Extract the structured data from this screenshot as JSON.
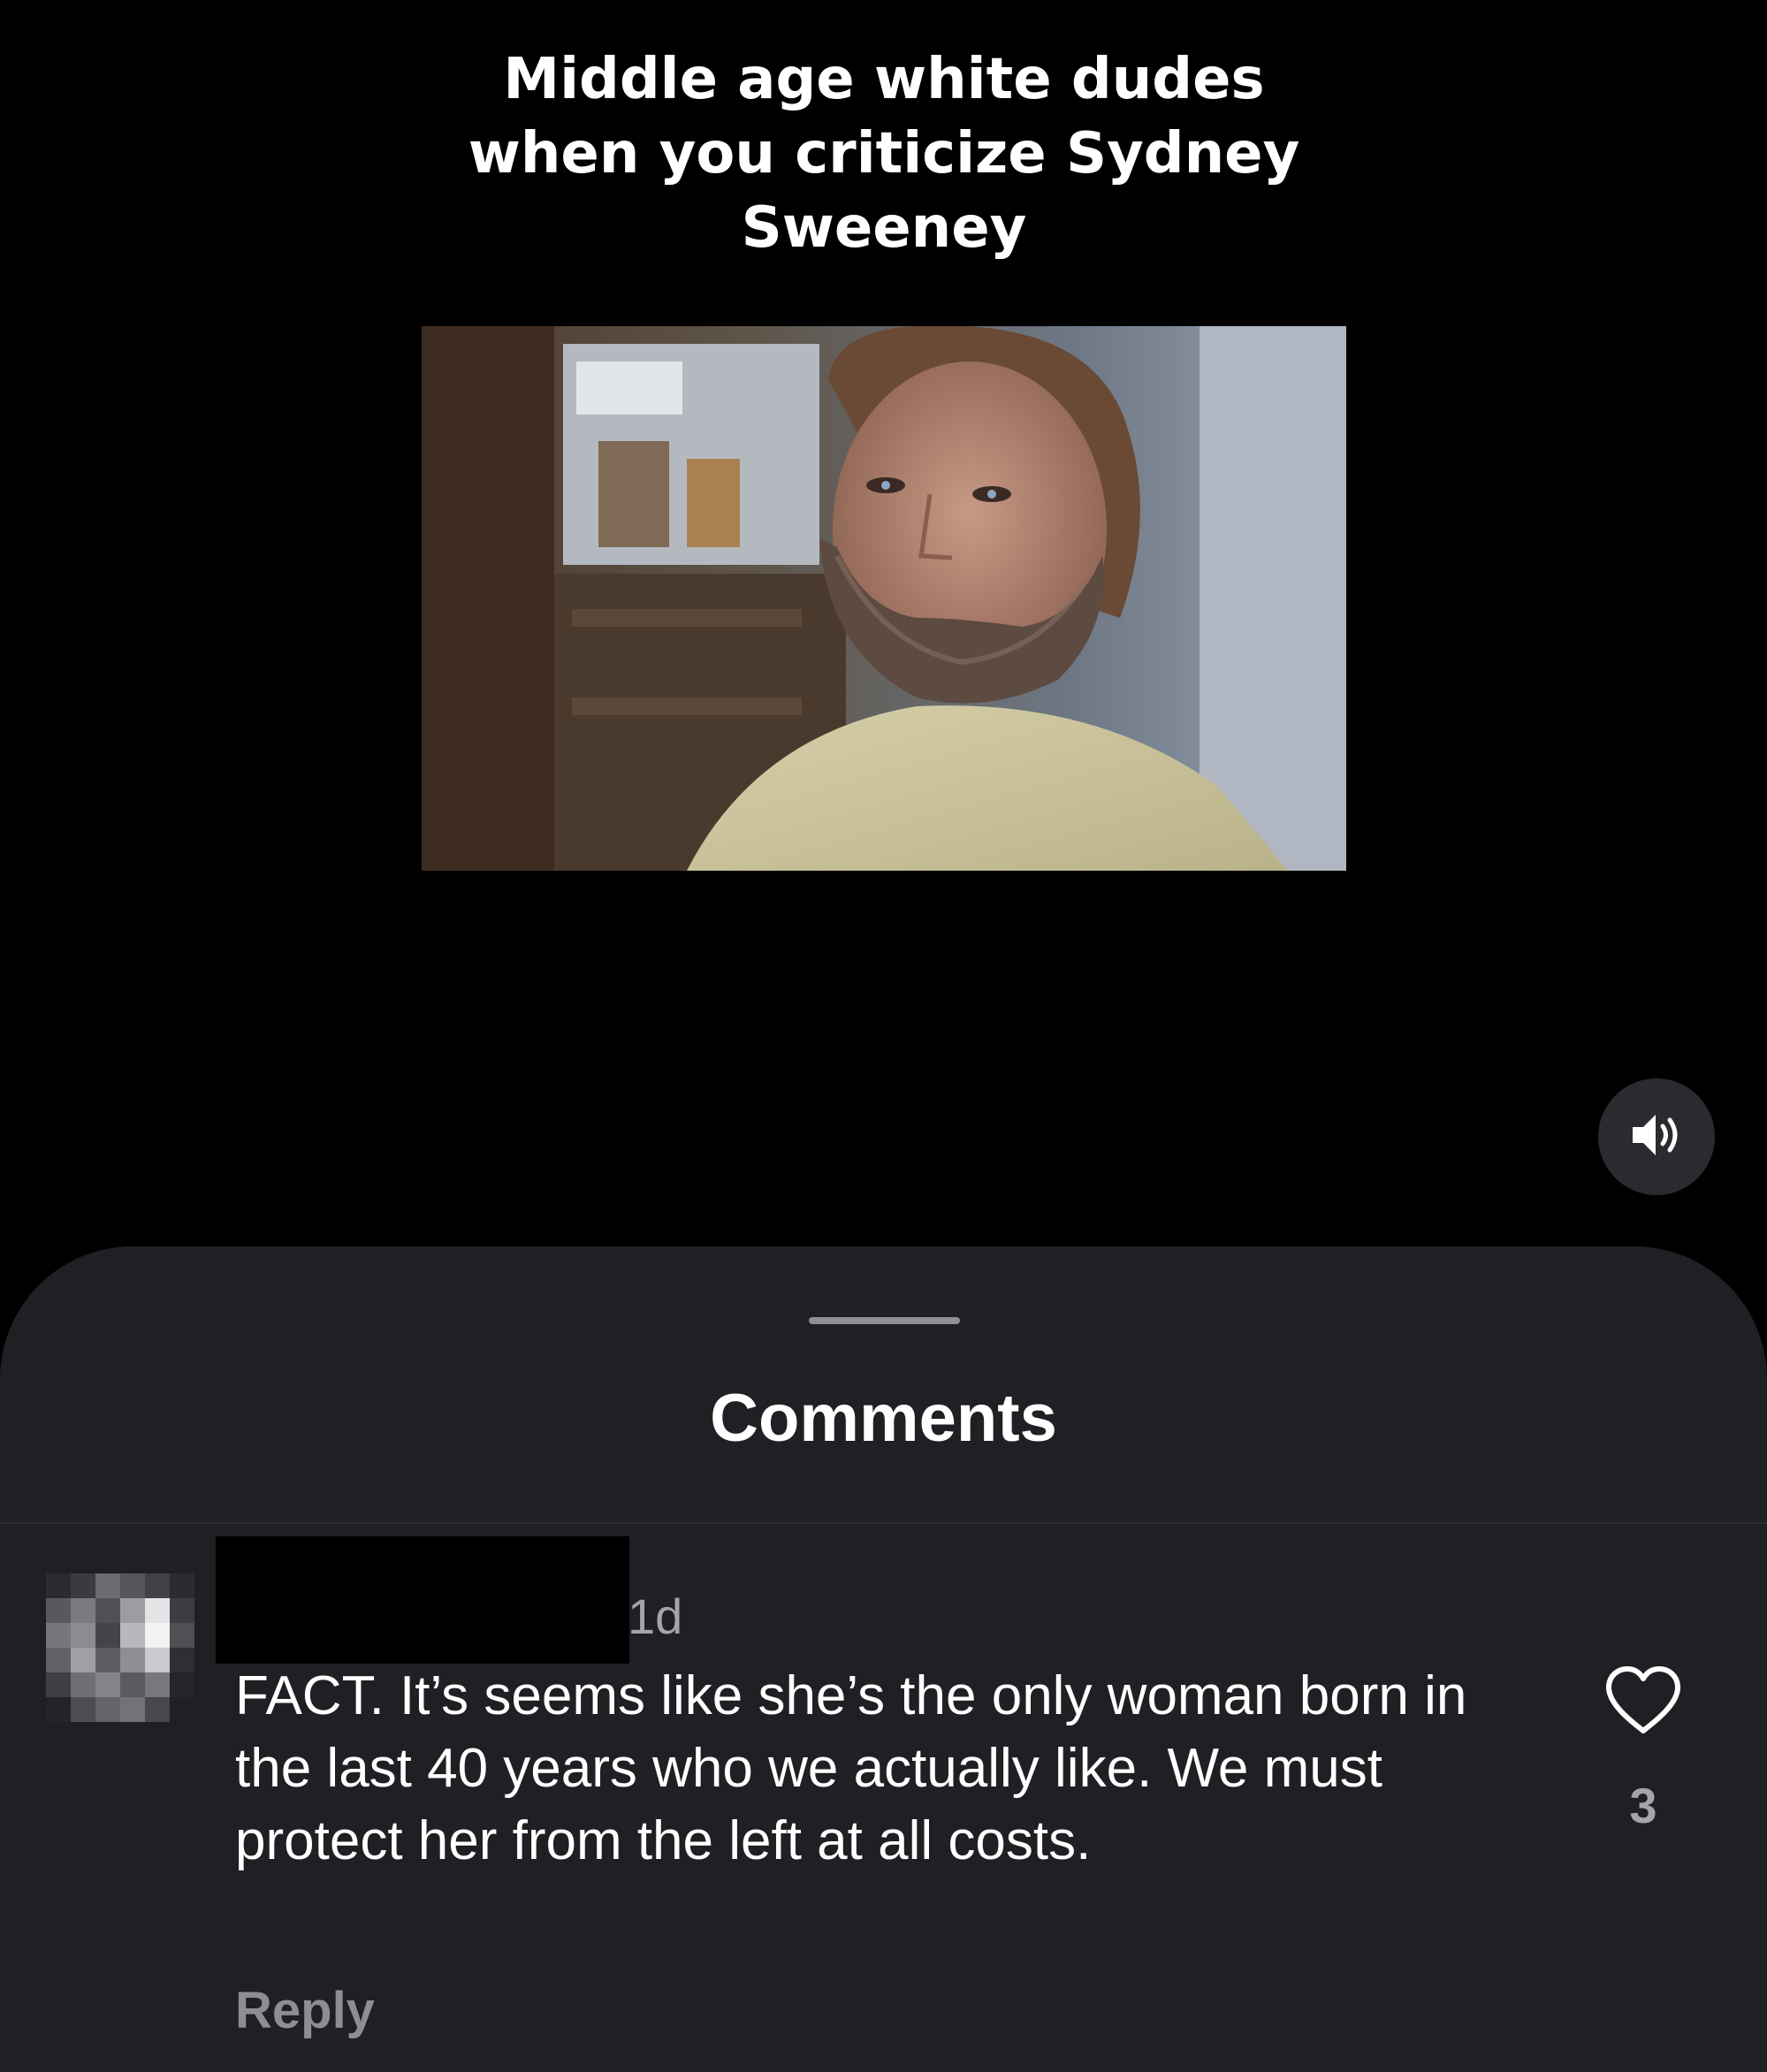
{
  "post": {
    "caption": "Middle age white dudes\nwhen you criticize Sydney\nSweeney",
    "image_description_icon": "movie-still"
  },
  "controls": {
    "volume_icon": "speaker-volume-icon"
  },
  "comments_sheet": {
    "title": "Comments",
    "comments": [
      {
        "username": "",
        "timestamp": "1d",
        "text": "FACT. It’s seems like she’s the only woman born in the last 40 years who we actually like. We must protect her from the left at all costs.",
        "reply_label": "Reply",
        "like_count": "3",
        "like_icon": "heart-icon"
      }
    ]
  },
  "colors": {
    "background": "#000000",
    "sheet": "#1f2024",
    "secondary_text": "#a4a5a9",
    "reply_text": "#8d8e92"
  }
}
